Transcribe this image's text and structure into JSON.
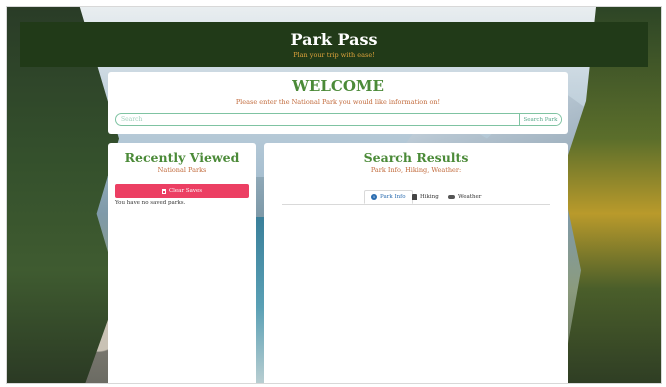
{
  "header": {
    "title": "Park Pass",
    "tagline": "Plan your trip with ease!"
  },
  "welcome": {
    "heading": "WELCOME",
    "subtitle": "Please enter the National Park you would like information on!",
    "search_placeholder": "Search",
    "search_button": "Search Park"
  },
  "recent": {
    "heading": "Recently Viewed",
    "subtitle": "National Parks",
    "clear_button": "Clear Saves",
    "empty_text": "You have no saved parks."
  },
  "results": {
    "heading": "Search Results",
    "subtitle": "Park Info, Hiking, Weather:",
    "tabs": [
      {
        "label": "Park Info",
        "icon": "info-icon",
        "active": true
      },
      {
        "label": "Hiking",
        "icon": "hiking-icon",
        "active": false
      },
      {
        "label": "Weather",
        "icon": "cloud-icon",
        "active": false
      }
    ]
  },
  "colors": {
    "header_bg": "#213a18",
    "heading_green": "#4b8a38",
    "subtitle_orange": "#c1693a",
    "clear_button": "#ec3f63",
    "tab_active": "#2b6cb0"
  }
}
